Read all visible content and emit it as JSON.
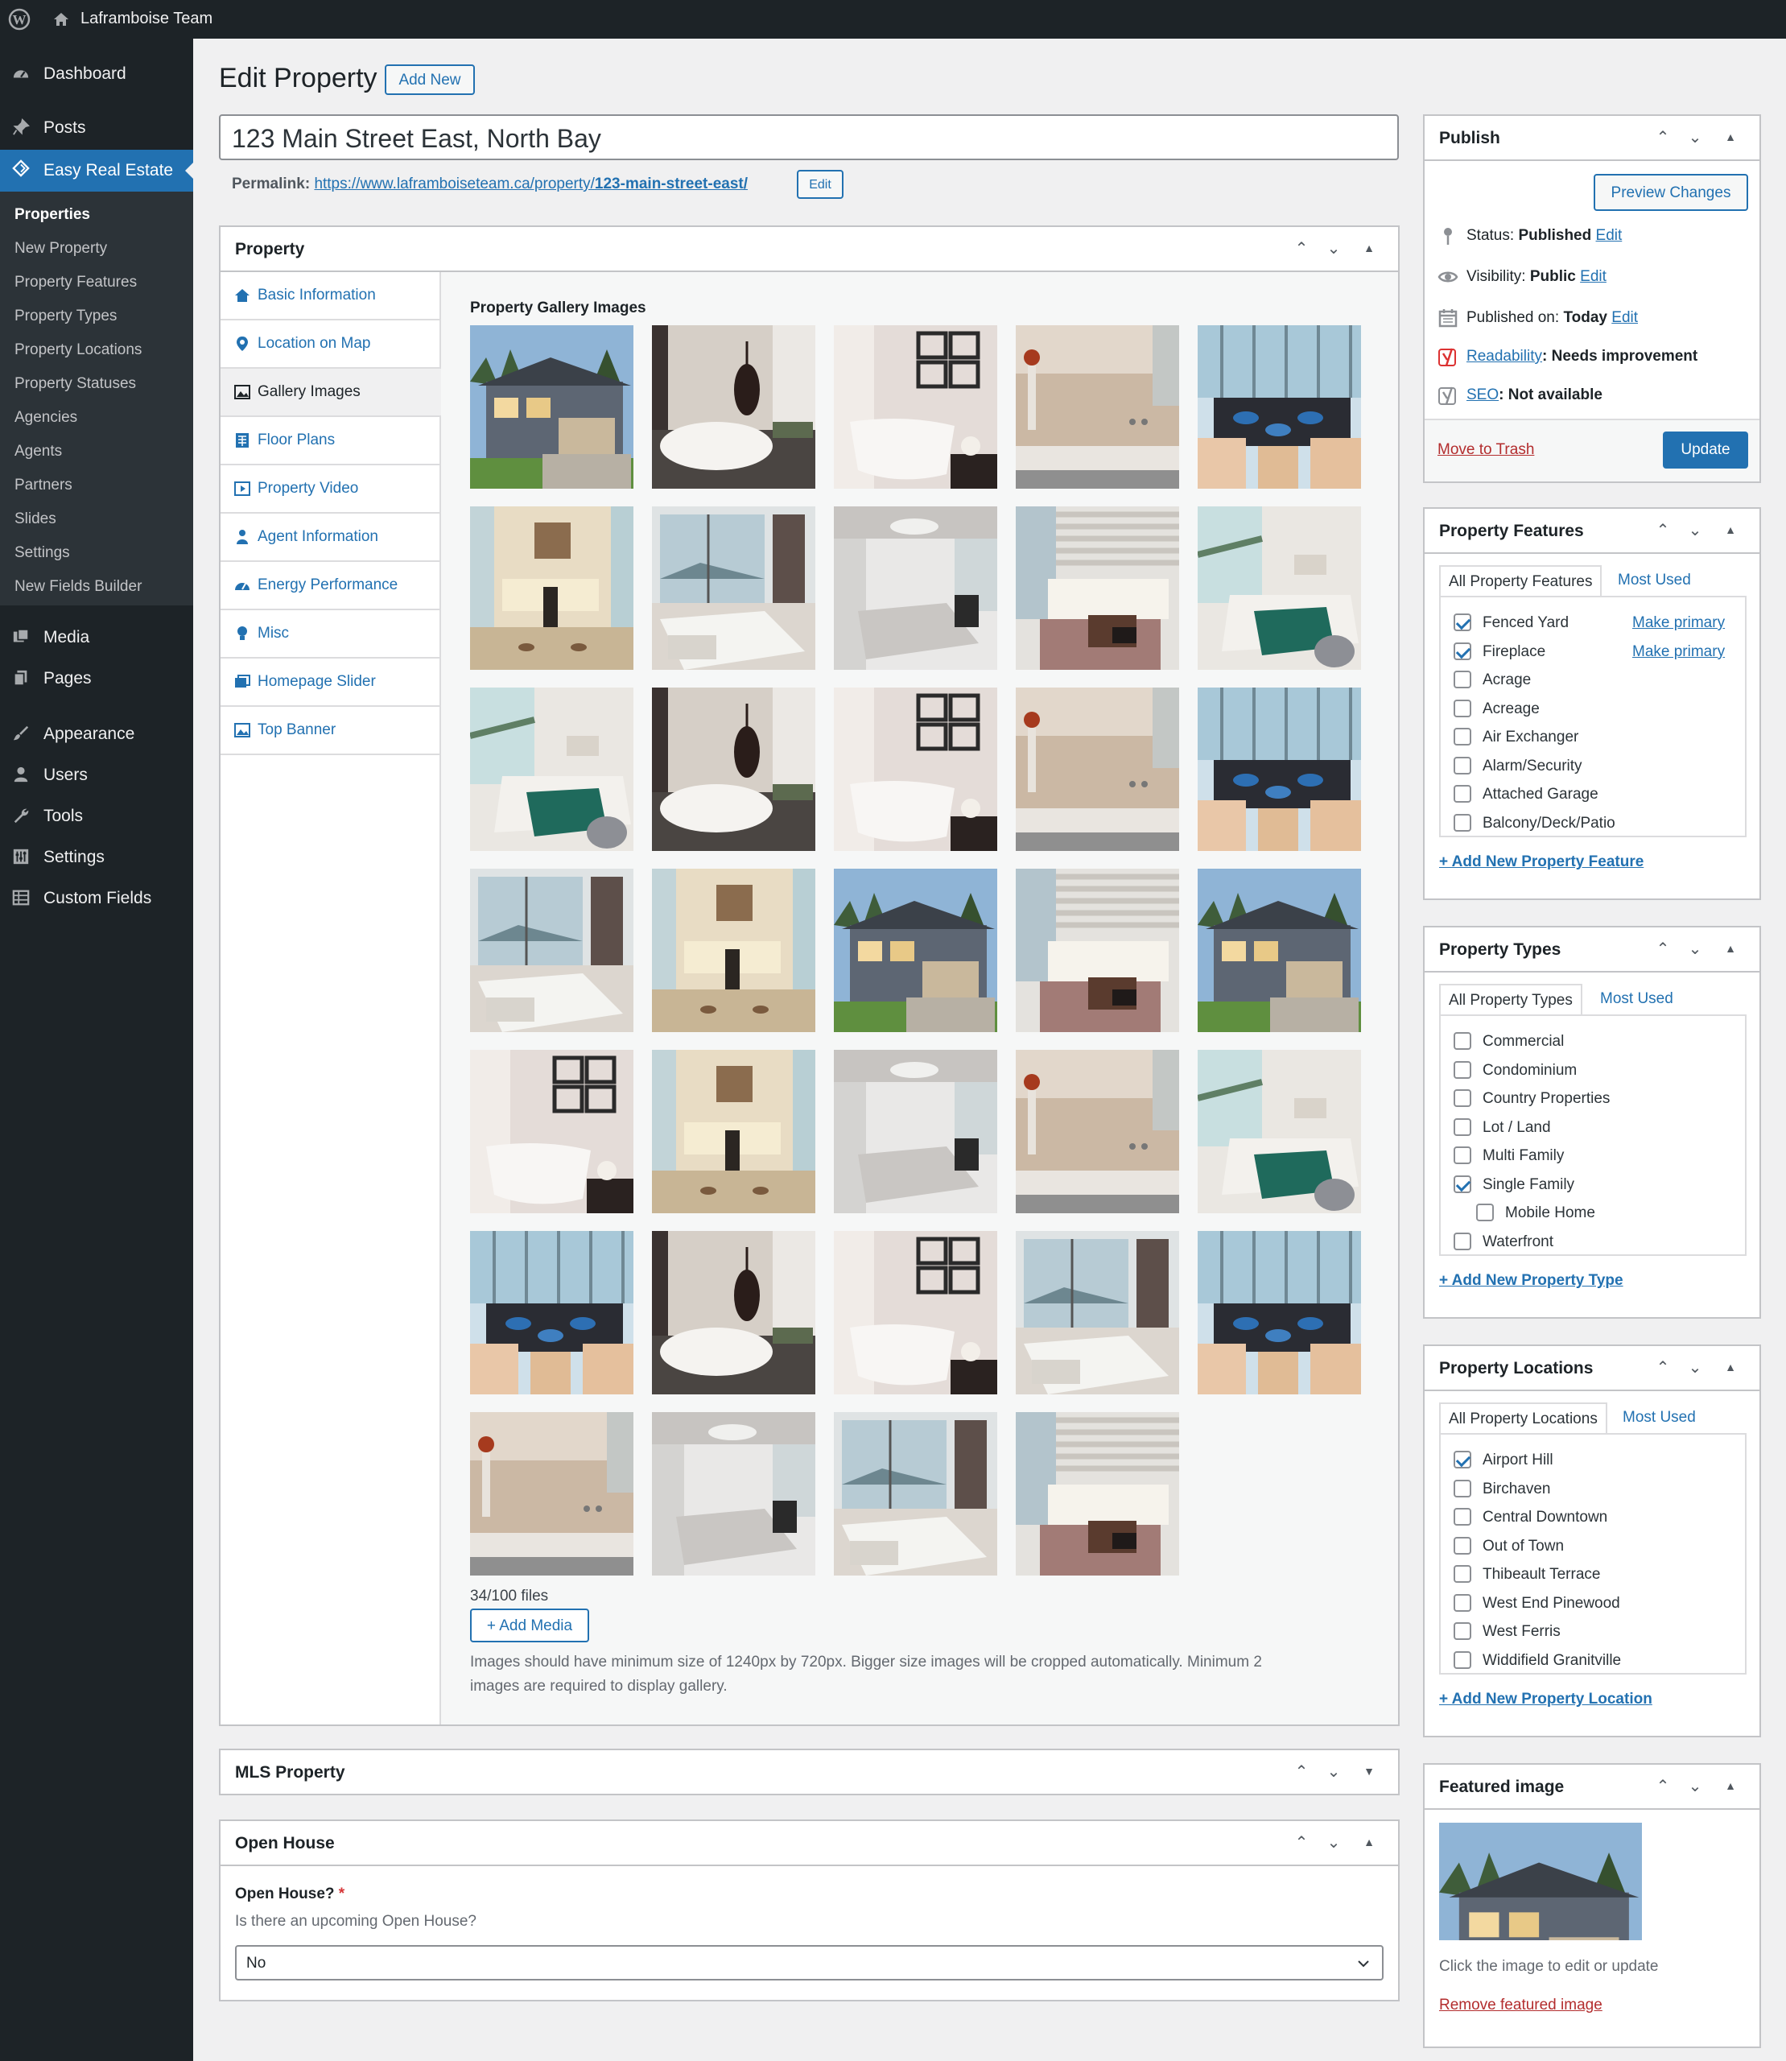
{
  "adminbar": {
    "site_name": "Laframboise Team",
    "wp_icon": "wordpress-logo-icon",
    "home_icon": "home-icon"
  },
  "sidebar": {
    "dashboard": "Dashboard",
    "posts": "Posts",
    "active": "Easy Real Estate",
    "submenu": [
      "Properties",
      "New Property",
      "Property Features",
      "Property Types",
      "Property Locations",
      "Property Statuses",
      "Agencies",
      "Agents",
      "Partners",
      "Slides",
      "Settings",
      "New Fields Builder"
    ],
    "media": "Media",
    "pages": "Pages",
    "appearance": "Appearance",
    "users": "Users",
    "tools": "Tools",
    "settings": "Settings",
    "custom_fields": "Custom Fields"
  },
  "page": {
    "title": "Edit Property",
    "add_new": "Add New",
    "post_title": "123 Main Street East, North Bay",
    "permalink_label": "Permalink:",
    "permalink_base": "https://www.laframboiseteam.ca/property/",
    "permalink_slug": "123-main-street-east/",
    "permalink_edit": "Edit"
  },
  "property_box": {
    "title": "Property",
    "tabs": [
      "Basic Information",
      "Location on Map",
      "Gallery Images",
      "Floor Plans",
      "Property Video",
      "Agent Information",
      "Energy Performance",
      "Misc",
      "Homepage Slider",
      "Top Banner"
    ],
    "gallery_title": "Property Gallery Images",
    "files_count": "34/100 files",
    "add_media": "+ Add Media",
    "help_line1": "Images should have minimum size of 1240px by 720px. Bigger size images will be cropped automatically. Minimum 2",
    "help_line2": "images are required to display gallery.",
    "thumbnails": [
      "house",
      "bath-vase",
      "tub-frames",
      "bath-wall",
      "dining",
      "dining-hall",
      "bed-view",
      "bed-chandelier",
      "living",
      "bed-green",
      "bed-green",
      "bath-vase",
      "tub-frames",
      "bath-wall",
      "dining",
      "bed-view",
      "dining-hall",
      "house",
      "living",
      "house",
      "tub-frames",
      "dining-hall",
      "bed-chandelier",
      "bath-wall",
      "bed-green",
      "dining",
      "bath-vase",
      "tub-frames",
      "bed-view",
      "dining",
      "bath-wall",
      "bed-chandelier",
      "bed-view",
      "living"
    ]
  },
  "mls_box": {
    "title": "MLS Property"
  },
  "open_house": {
    "title": "Open House",
    "field_label": "Open House?",
    "required": "*",
    "description": "Is there an upcoming Open House?",
    "value": "No"
  },
  "publish": {
    "title": "Publish",
    "preview": "Preview Changes",
    "status_label": "Status:",
    "status_value": "Published",
    "status_edit": "Edit",
    "visibility_label": "Visibility:",
    "visibility_value": "Public",
    "visibility_edit": "Edit",
    "published_label": "Published on:",
    "published_value": "Today",
    "published_edit": "Edit",
    "readability_link": "Readability",
    "readability_value": ": Needs improvement",
    "seo_link": "SEO",
    "seo_value": ": Not available",
    "trash": "Move to Trash",
    "update": "Update"
  },
  "features": {
    "title": "Property Features",
    "tab_all": "All Property Features",
    "tab_most": "Most Used",
    "items": [
      {
        "label": "Fenced Yard",
        "checked": true,
        "primary": "Make primary"
      },
      {
        "label": "Fireplace",
        "checked": true,
        "primary": "Make primary"
      },
      {
        "label": "Acrage",
        "checked": false
      },
      {
        "label": "Acreage",
        "checked": false
      },
      {
        "label": "Air Exchanger",
        "checked": false
      },
      {
        "label": "Alarm/Security",
        "checked": false
      },
      {
        "label": "Attached Garage",
        "checked": false
      },
      {
        "label": "Balcony/Deck/Patio",
        "checked": false
      }
    ],
    "add_new": "+ Add New Property Feature"
  },
  "types": {
    "title": "Property Types",
    "tab_all": "All Property Types",
    "tab_most": "Most Used",
    "items": [
      {
        "label": "Commercial",
        "checked": false
      },
      {
        "label": "Condominium",
        "checked": false
      },
      {
        "label": "Country Properties",
        "checked": false
      },
      {
        "label": "Lot / Land",
        "checked": false
      },
      {
        "label": "Multi Family",
        "checked": false
      },
      {
        "label": "Single Family",
        "checked": true
      },
      {
        "label": "Mobile Home",
        "checked": false,
        "indent": true
      },
      {
        "label": "Waterfront",
        "checked": false
      }
    ],
    "add_new": "+ Add New Property Type"
  },
  "locations": {
    "title": "Property Locations",
    "tab_all": "All Property Locations",
    "tab_most": "Most Used",
    "items": [
      {
        "label": "Airport Hill",
        "checked": true
      },
      {
        "label": "Birchaven",
        "checked": false
      },
      {
        "label": "Central Downtown",
        "checked": false
      },
      {
        "label": "Out of Town",
        "checked": false
      },
      {
        "label": "Thibeault Terrace",
        "checked": false
      },
      {
        "label": "West End Pinewood",
        "checked": false
      },
      {
        "label": "West Ferris",
        "checked": false
      },
      {
        "label": "Widdifield Granitville",
        "checked": false
      }
    ],
    "add_new": "+ Add New Property Location"
  },
  "featured": {
    "title": "Featured image",
    "caption": "Click the image to edit or update",
    "remove": "Remove featured image"
  },
  "colors": {
    "admin_dark": "#1d2327",
    "accent": "#2271b1",
    "trash_red": "#b32d2e",
    "yoast_red": "#dc3232"
  }
}
